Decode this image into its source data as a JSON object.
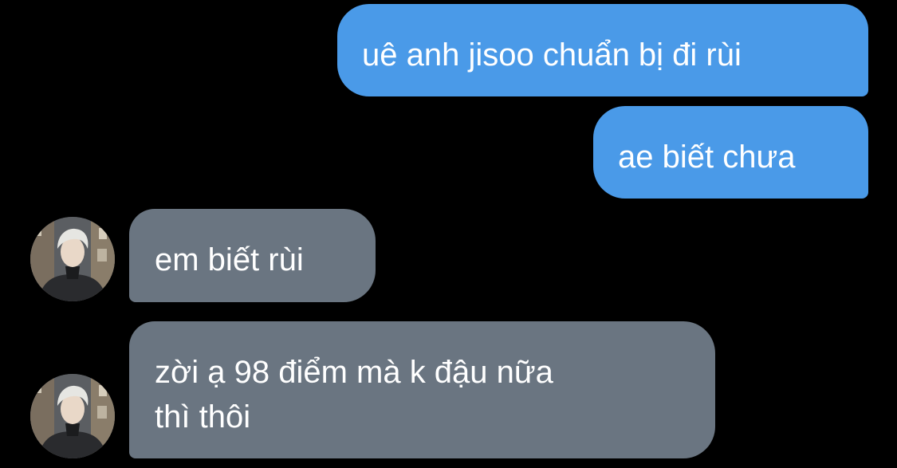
{
  "conversation": {
    "messages": [
      {
        "direction": "outgoing",
        "text": "uê anh jisoo chuẩn bị đi rùi"
      },
      {
        "direction": "outgoing",
        "text": "ae biết chưa"
      },
      {
        "direction": "incoming",
        "text": "em biết rùi",
        "avatar": "contact-photo"
      },
      {
        "direction": "incoming",
        "text": "zời ạ 98 điểm mà k đậu nữa\nthì thôi",
        "avatar": "contact-photo"
      }
    ]
  },
  "colors": {
    "background": "#000000",
    "outgoing_bubble": "#4a9ae8",
    "incoming_bubble": "#6a7581",
    "text": "#ffffff"
  }
}
